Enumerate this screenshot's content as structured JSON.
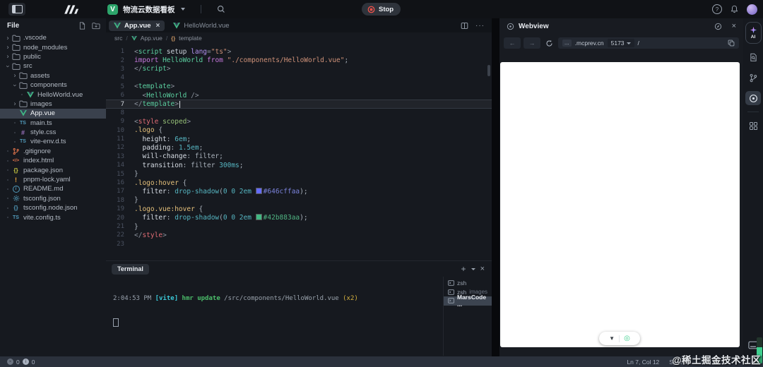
{
  "topbar": {
    "workspace_name": "物流云数据看板",
    "stop_label": "Stop",
    "icons": [
      "panel-toggle-icon",
      "marscode-logo",
      "workspace-badge-icon",
      "chevron-down-icon",
      "search-icon",
      "stop-icon",
      "help-icon",
      "bell-icon",
      "avatar"
    ]
  },
  "explorer": {
    "title": "File",
    "header_icons": [
      "new-file-icon",
      "new-folder-icon"
    ],
    "items": [
      {
        "label": ".vscode",
        "icon": "folder-icon",
        "depth": 0,
        "type": "folder",
        "expanded": false
      },
      {
        "label": "node_modules",
        "icon": "folder-icon",
        "depth": 0,
        "type": "folder",
        "expanded": false
      },
      {
        "label": "public",
        "icon": "folder-icon",
        "depth": 0,
        "type": "folder",
        "expanded": false
      },
      {
        "label": "src",
        "icon": "folder-icon",
        "depth": 0,
        "type": "folder",
        "expanded": true
      },
      {
        "label": "assets",
        "icon": "folder-icon",
        "depth": 1,
        "type": "folder",
        "expanded": false
      },
      {
        "label": "components",
        "icon": "folder-icon",
        "depth": 1,
        "type": "folder",
        "expanded": true
      },
      {
        "label": "HelloWorld.vue",
        "icon": "vue-icon",
        "depth": 2,
        "type": "file"
      },
      {
        "label": "images",
        "icon": "folder-icon",
        "depth": 1,
        "type": "folder",
        "expanded": false
      },
      {
        "label": "App.vue",
        "icon": "vue-icon",
        "depth": 1,
        "type": "file",
        "selected": true
      },
      {
        "label": "main.ts",
        "icon": "ts-icon",
        "depth": 1,
        "type": "file"
      },
      {
        "label": "style.css",
        "icon": "css-icon",
        "depth": 1,
        "type": "file"
      },
      {
        "label": "vite-env.d.ts",
        "icon": "ts-icon",
        "depth": 1,
        "type": "file"
      },
      {
        "label": ".gitignore",
        "icon": "git-icon",
        "depth": 0,
        "type": "file"
      },
      {
        "label": "index.html",
        "icon": "html-icon",
        "depth": 0,
        "type": "file"
      },
      {
        "label": "package.json",
        "icon": "json-icon",
        "depth": 0,
        "type": "file"
      },
      {
        "label": "pnpm-lock.yaml",
        "icon": "yaml-icon",
        "depth": 0,
        "type": "file"
      },
      {
        "label": "README.md",
        "icon": "md-icon",
        "depth": 0,
        "type": "file"
      },
      {
        "label": "tsconfig.json",
        "icon": "gear-icon",
        "depth": 0,
        "type": "file"
      },
      {
        "label": "tsconfig.node.json",
        "icon": "json-blue-icon",
        "depth": 0,
        "type": "file"
      },
      {
        "label": "vite.config.ts",
        "icon": "ts-icon",
        "depth": 0,
        "type": "file"
      }
    ]
  },
  "editor": {
    "tabs": [
      {
        "label": "App.vue",
        "icon": "vue-icon",
        "active": true,
        "closable": true
      },
      {
        "label": "HelloWorld.vue",
        "icon": "vue-icon",
        "active": false
      }
    ],
    "tab_actions": [
      "split-editor-icon",
      "more-actions-icon"
    ],
    "breadcrumb": {
      "root": "src",
      "file": "App.vue",
      "symbol": "template"
    },
    "lines": [
      {
        "n": 1,
        "s": [
          [
            "<",
            "p"
          ],
          [
            "script",
            "t"
          ],
          [
            " ",
            "w"
          ],
          [
            "setup",
            "a"
          ],
          [
            " ",
            "w"
          ],
          [
            "lang",
            "ap"
          ],
          [
            "=",
            "p"
          ],
          [
            "\"ts\"",
            "s"
          ],
          [
            ">",
            "p"
          ]
        ]
      },
      {
        "n": 2,
        "s": [
          [
            "import",
            "k"
          ],
          [
            " ",
            "w"
          ],
          [
            "HelloWorld",
            "c"
          ],
          [
            " ",
            "w"
          ],
          [
            "from",
            "k"
          ],
          [
            " ",
            "w"
          ],
          [
            "\"./components/HelloWorld.vue\"",
            "s"
          ],
          [
            ";",
            "w"
          ]
        ]
      },
      {
        "n": 3,
        "s": [
          [
            "</",
            "p"
          ],
          [
            "script",
            "t"
          ],
          [
            ">",
            "p"
          ]
        ]
      },
      {
        "n": 4,
        "s": []
      },
      {
        "n": 5,
        "s": [
          [
            "<",
            "p"
          ],
          [
            "template",
            "t"
          ],
          [
            ">",
            "p"
          ]
        ]
      },
      {
        "n": 6,
        "s": [
          [
            "  <",
            "p"
          ],
          [
            "HelloWorld",
            "c"
          ],
          [
            " />",
            "p"
          ]
        ]
      },
      {
        "n": 7,
        "s": [
          [
            "</",
            "p"
          ],
          [
            "template",
            "t"
          ],
          [
            ">",
            "p"
          ]
        ],
        "current": true,
        "caret": true
      },
      {
        "n": 8,
        "s": []
      },
      {
        "n": 9,
        "s": [
          [
            "<",
            "p"
          ],
          [
            "style",
            "r"
          ],
          [
            " ",
            "w"
          ],
          [
            "scoped",
            "g"
          ],
          [
            ">",
            "p"
          ]
        ]
      },
      {
        "n": 10,
        "s": [
          [
            ".logo",
            "se"
          ],
          [
            " {",
            "w"
          ]
        ]
      },
      {
        "n": 11,
        "s": [
          [
            "  ",
            "w"
          ],
          [
            "height",
            "pr"
          ],
          [
            ": ",
            "w"
          ],
          [
            "6em",
            "u"
          ],
          [
            ";",
            "w"
          ]
        ]
      },
      {
        "n": 12,
        "s": [
          [
            "  ",
            "w"
          ],
          [
            "padding",
            "pr"
          ],
          [
            ": ",
            "w"
          ],
          [
            "1.5em",
            "u"
          ],
          [
            ";",
            "w"
          ]
        ]
      },
      {
        "n": 13,
        "s": [
          [
            "  ",
            "w"
          ],
          [
            "will-change",
            "pr"
          ],
          [
            ": ",
            "w"
          ],
          [
            "filter",
            "w"
          ],
          [
            ";",
            "w"
          ]
        ]
      },
      {
        "n": 14,
        "s": [
          [
            "  ",
            "w"
          ],
          [
            "transition",
            "pr"
          ],
          [
            ": ",
            "w"
          ],
          [
            "filter ",
            "w"
          ],
          [
            "300ms",
            "u"
          ],
          [
            ";",
            "w"
          ]
        ]
      },
      {
        "n": 15,
        "s": [
          [
            "}",
            "w"
          ]
        ]
      },
      {
        "n": 16,
        "s": [
          [
            ".logo:hover",
            "se"
          ],
          [
            " {",
            "w"
          ]
        ]
      },
      {
        "n": 17,
        "s": [
          [
            "  ",
            "w"
          ],
          [
            "filter",
            "pr"
          ],
          [
            ": ",
            "w"
          ],
          [
            "drop-shadow",
            "f"
          ],
          [
            "(",
            "w"
          ],
          [
            "0 0 2em ",
            "u"
          ],
          [
            "",
            "sw1"
          ],
          [
            "#646cffaa",
            "h1"
          ],
          [
            ");",
            "w"
          ]
        ]
      },
      {
        "n": 18,
        "s": [
          [
            "}",
            "w"
          ]
        ]
      },
      {
        "n": 19,
        "s": [
          [
            ".logo.vue:hover",
            "se"
          ],
          [
            " {",
            "w"
          ]
        ]
      },
      {
        "n": 20,
        "s": [
          [
            "  ",
            "w"
          ],
          [
            "filter",
            "pr"
          ],
          [
            ": ",
            "w"
          ],
          [
            "drop-shadow",
            "f"
          ],
          [
            "(",
            "w"
          ],
          [
            "0 0 2em ",
            "u"
          ],
          [
            "",
            "sw2"
          ],
          [
            "#42b883aa",
            "h2"
          ],
          [
            ");",
            "w"
          ]
        ]
      },
      {
        "n": 21,
        "s": [
          [
            "}",
            "w"
          ]
        ]
      },
      {
        "n": 22,
        "s": [
          [
            "</",
            "p"
          ],
          [
            "style",
            "r"
          ],
          [
            ">",
            "p"
          ]
        ]
      },
      {
        "n": 23,
        "s": []
      }
    ]
  },
  "terminal": {
    "title": "Terminal",
    "actions": [
      "new-terminal-icon",
      "terminal-dropdown-icon",
      "close-icon"
    ],
    "log": [
      {
        "t": "2:04:53 PM ",
        "c": "dim"
      },
      {
        "t": "[vite] ",
        "c": "cyan"
      },
      {
        "t": "hmr update ",
        "c": "green"
      },
      {
        "t": "/src/components/HelloWorld.vue ",
        "c": "path"
      },
      {
        "t": "(x2)",
        "c": "yellow"
      }
    ],
    "sessions": [
      {
        "label": "zsh"
      },
      {
        "label": "zsh",
        "suffix": "images"
      },
      {
        "label": "MarsCode ...",
        "selected": true
      }
    ]
  },
  "webview": {
    "title": "Webview",
    "header_icons": [
      "open-in-browser-icon",
      "close-icon"
    ],
    "nav_icons": [
      "back-icon",
      "forward-icon",
      "refresh-icon"
    ],
    "host_badge": "...",
    "host": ".mcprev.cn",
    "port": "5173",
    "path": "/",
    "overlay_icons": [
      "collapse-triangle-icon",
      "inspect-target-icon"
    ]
  },
  "activitybar": {
    "ai_label": "AI",
    "items": [
      "ai-assistant-button",
      "doc-search-icon",
      "source-control-icon",
      "webview-icon",
      "apps-grid-icon",
      "remote-terminal-icon"
    ]
  },
  "statusbar": {
    "errors": "0",
    "infos": "0",
    "line_col": "Ln 7, Col 12",
    "indent": "Spaces:"
  },
  "watermark": "@稀土掘金技术社区"
}
